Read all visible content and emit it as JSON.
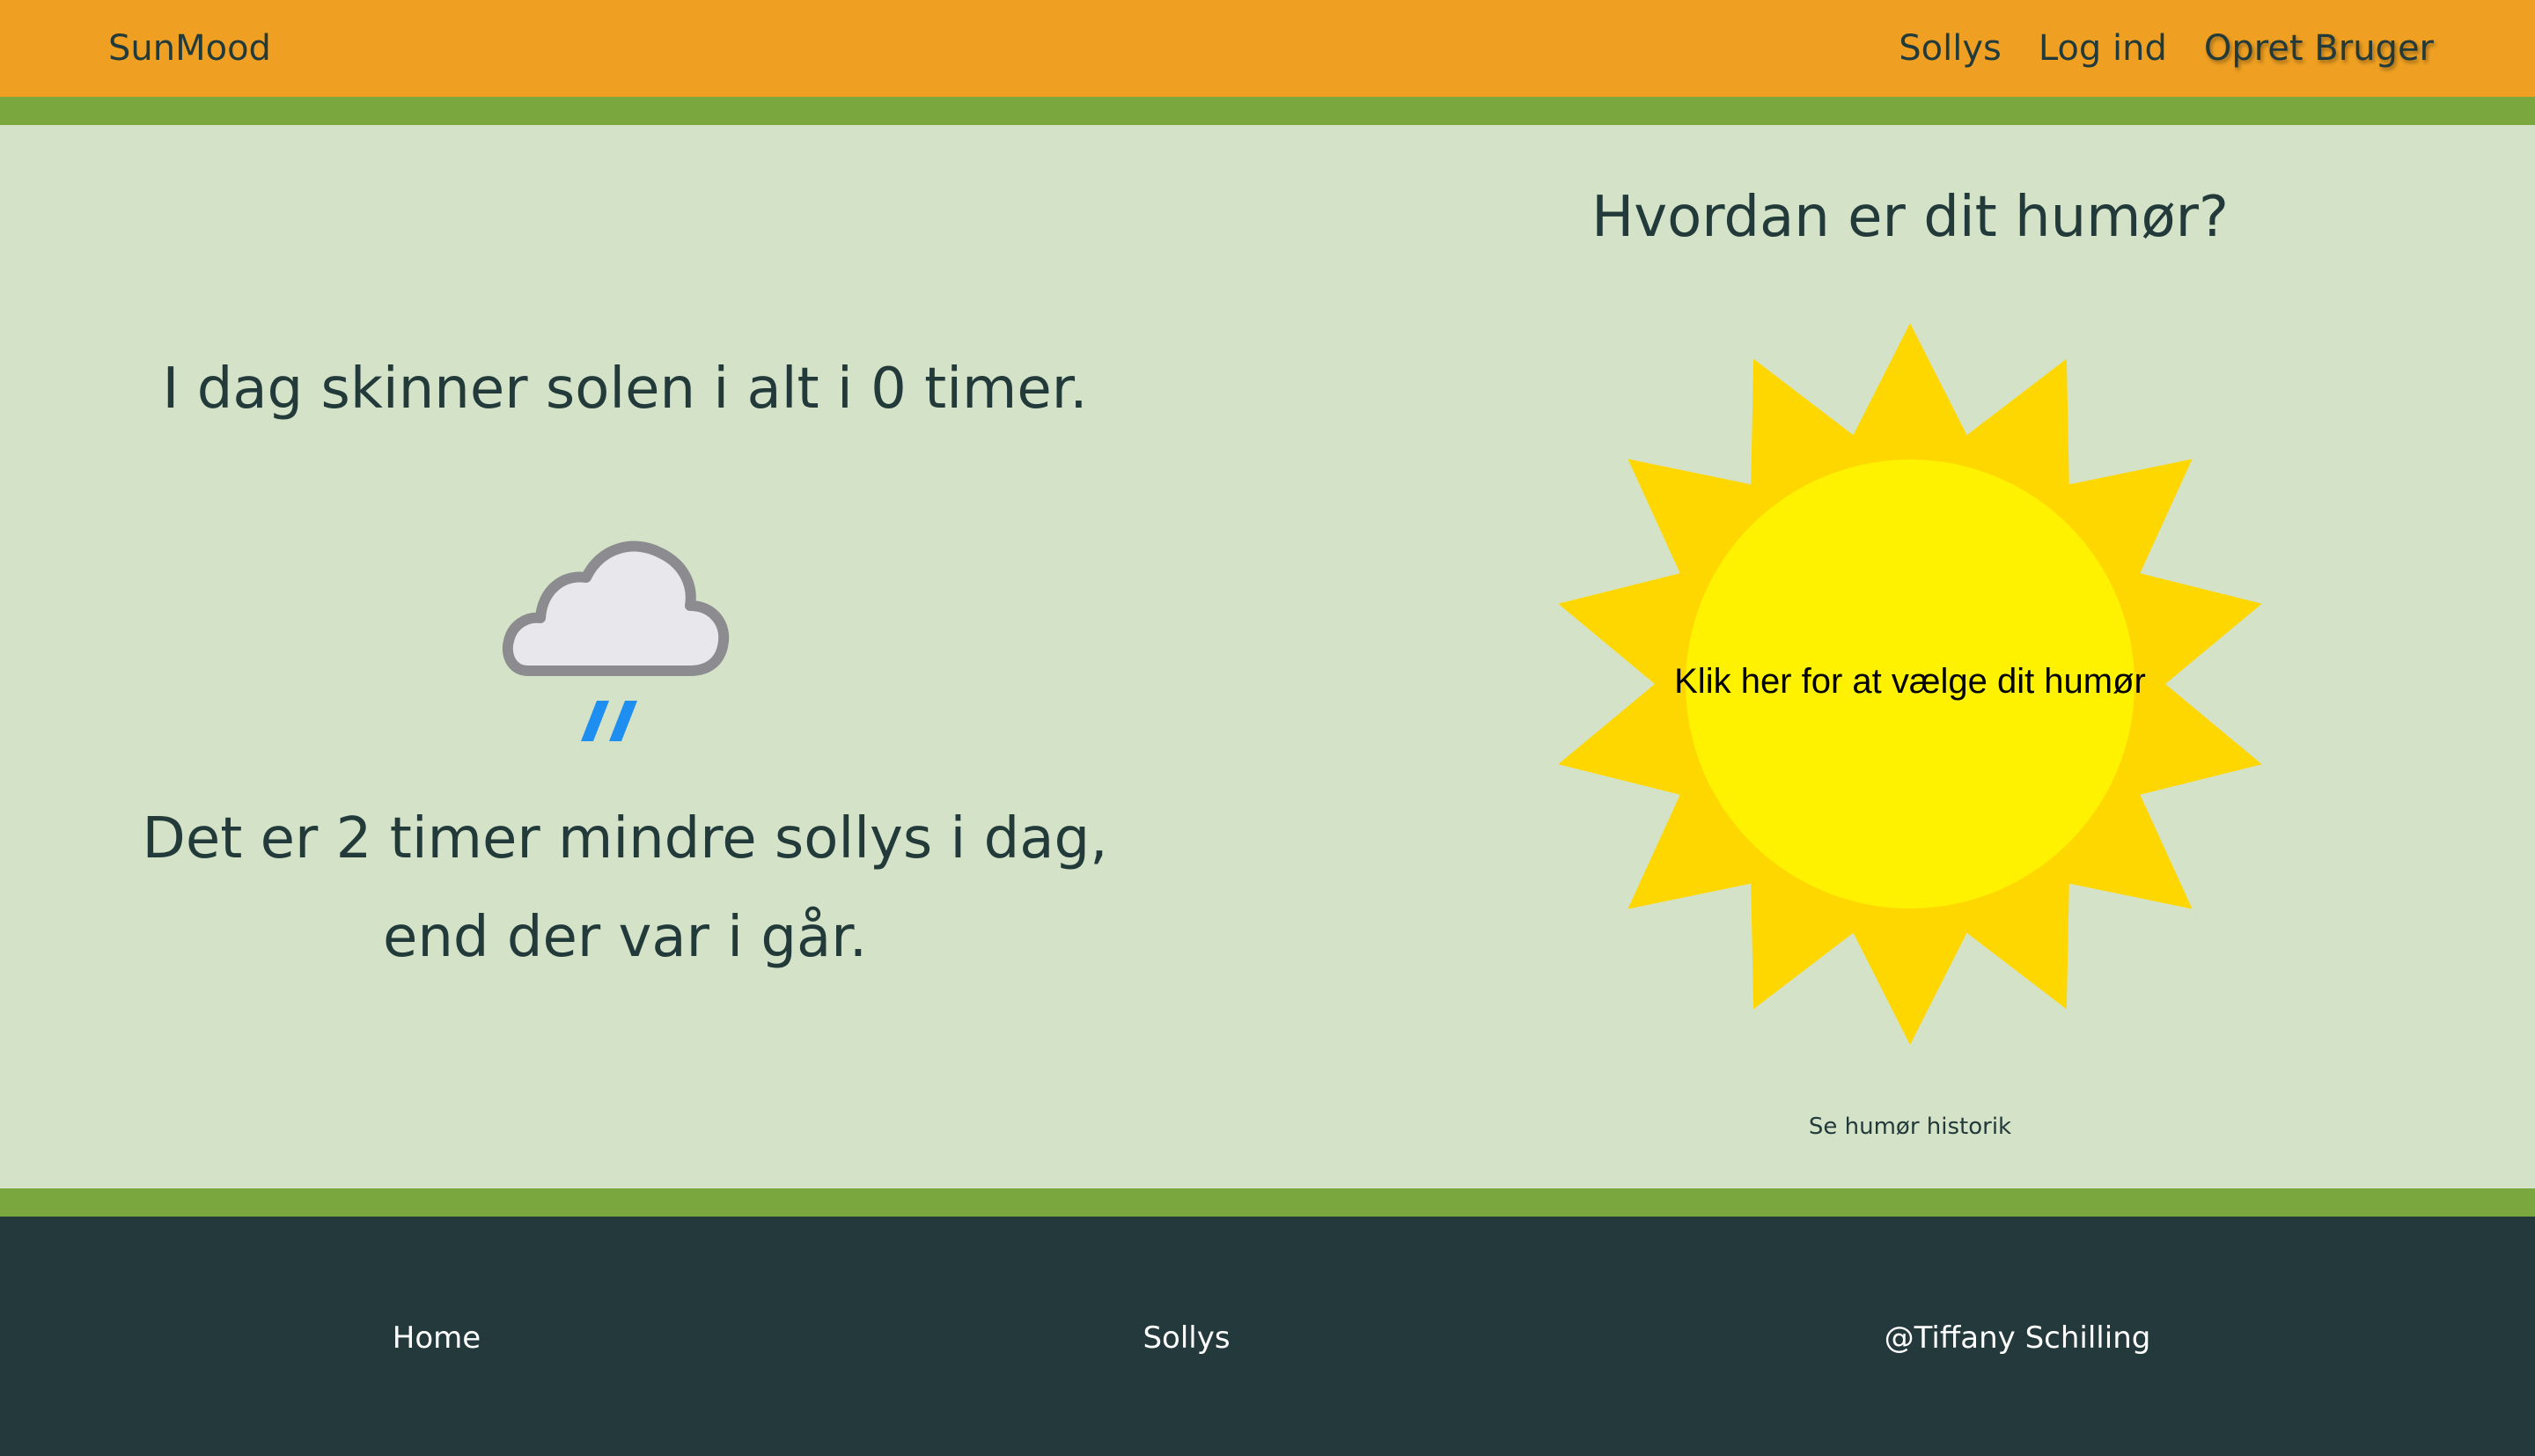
{
  "header": {
    "brand": "SunMood",
    "nav": [
      {
        "label": "Sollys"
      },
      {
        "label": "Log ind"
      },
      {
        "label": "Opret Bruger"
      }
    ]
  },
  "main": {
    "today_text": "I dag skinner solen i alt i 0 timer.",
    "weather_icon": "cloud-rain-icon",
    "compare_line1": "Det er 2 timer mindre sollys i dag,",
    "compare_line2": "end der var i går.",
    "mood_heading": "Hvordan er dit humør?",
    "sun_button_label": "Klik her for at vælge dit humør",
    "history_link": "Se humør historik"
  },
  "footer": {
    "home": "Home",
    "sollys": "Sollys",
    "credit": "@Tiffany Schilling"
  },
  "colors": {
    "header_bg": "#efa022",
    "stripe": "#7aa83f",
    "main_bg": "#d4e3c7",
    "footer_bg": "#23393c",
    "text": "#233a3b",
    "sun_rays": "#ffd700",
    "sun_core": "#fff200"
  }
}
